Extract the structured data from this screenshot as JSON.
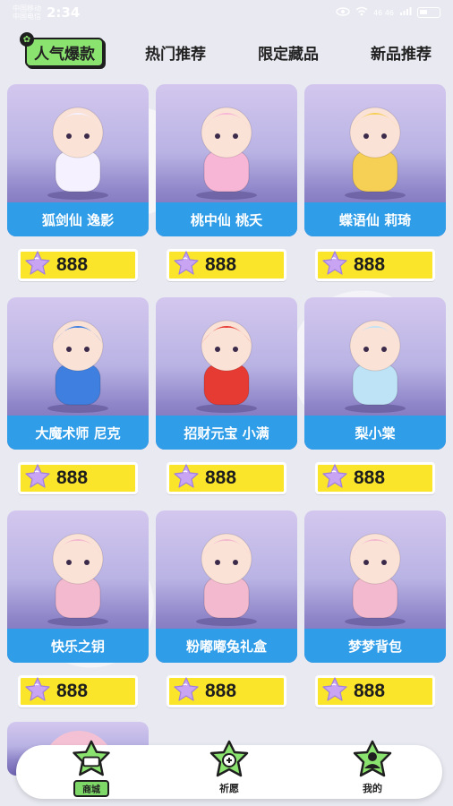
{
  "status_bar": {
    "carrier1": "中国移动",
    "carrier2": "中国电信",
    "time": "2:34",
    "signal": "46 46"
  },
  "tabs": [
    {
      "label": "人气爆款",
      "active": true
    },
    {
      "label": "热门推荐",
      "active": false
    },
    {
      "label": "限定藏品",
      "active": false
    },
    {
      "label": "新品推荐",
      "active": false
    }
  ],
  "products": [
    {
      "name": "狐剑仙 逸影",
      "price": "888",
      "accent": "#f5f1ff"
    },
    {
      "name": "桃中仙 桃夭",
      "price": "888",
      "accent": "#f7b6d6"
    },
    {
      "name": "蝶语仙 莉琦",
      "price": "888",
      "accent": "#f6cf55"
    },
    {
      "name": "大魔术师 尼克",
      "price": "888",
      "accent": "#3f7fe0"
    },
    {
      "name": "招财元宝 小满",
      "price": "888",
      "accent": "#e63b33"
    },
    {
      "name": "梨小棠",
      "price": "888",
      "accent": "#bfe3f6"
    },
    {
      "name": "快乐之钥",
      "price": "888",
      "accent": "#f3b9cf"
    },
    {
      "name": "粉嘟嘟兔礼盒",
      "price": "888",
      "accent": "#f3b9cf"
    },
    {
      "name": "梦梦背包",
      "price": "888",
      "accent": "#f3b9cf"
    }
  ],
  "bottom_nav": [
    {
      "label": "商城",
      "icon": "shop-star-icon",
      "active": true
    },
    {
      "label": "祈愿",
      "icon": "wish-star-icon",
      "active": false
    },
    {
      "label": "我的",
      "icon": "profile-star-icon",
      "active": false
    }
  ],
  "colors": {
    "accent_green": "#8be36f",
    "card_label_blue": "#2f9de8",
    "price_yellow": "#fbe52a"
  }
}
